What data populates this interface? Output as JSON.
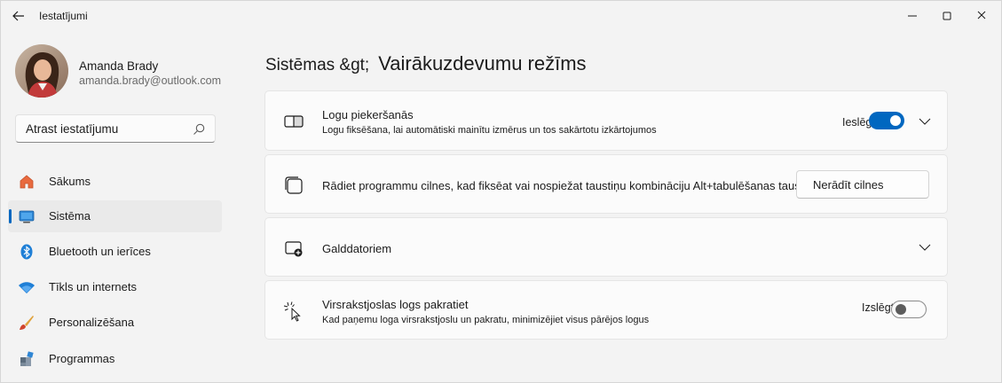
{
  "window": {
    "title": "Iestatījumi"
  },
  "profile": {
    "name": "Amanda Brady",
    "email": "amanda.brady@outlook.com"
  },
  "search": {
    "placeholder": "Atrast iestatījumu"
  },
  "nav": {
    "items": [
      {
        "label": "Sākums",
        "icon": "home-icon",
        "active": false
      },
      {
        "label": "Sistēma",
        "icon": "monitor-icon",
        "active": true
      },
      {
        "label": "Bluetooth un ierīces",
        "icon": "bluetooth-icon",
        "active": false
      },
      {
        "label": "Tīkls un internets",
        "icon": "wifi-icon",
        "active": false
      },
      {
        "label": "Personalizēšana",
        "icon": "brush-icon",
        "active": false
      },
      {
        "label": "Programmas",
        "icon": "apps-icon",
        "active": false
      }
    ]
  },
  "page": {
    "breadcrumb": "Sistēmas &gt;",
    "title": "Vairākuzdevumu režīms"
  },
  "cards": {
    "snap": {
      "title": "Logu piekeršanās",
      "subtitle": "Logu fiksēšana, lai automātiski mainītu izmērus un tos sakārtotu izkārtojumos",
      "toggle_label": "Ieslēgts",
      "toggle_on": true
    },
    "tabs": {
      "title": "Rādiet programmu cilnes, kad fiksēat vai nospiežat taustiņu kombināciju Alt+tabulēšanas taustiņš",
      "button_label": "Nerādīt cilnes"
    },
    "desktops": {
      "title": "Galddatoriem"
    },
    "shake": {
      "title": "Virsrakstjoslas logs pakratiet",
      "subtitle": "Kad paņemu loga virsrakstjoslu un pakratu, minimizējiet visus pārējos logus",
      "toggle_label": "Izslēgts",
      "toggle_on": false
    }
  },
  "colors": {
    "accent": "#0067c0",
    "background": "#f3f3f3",
    "card": "#fbfbfb"
  }
}
